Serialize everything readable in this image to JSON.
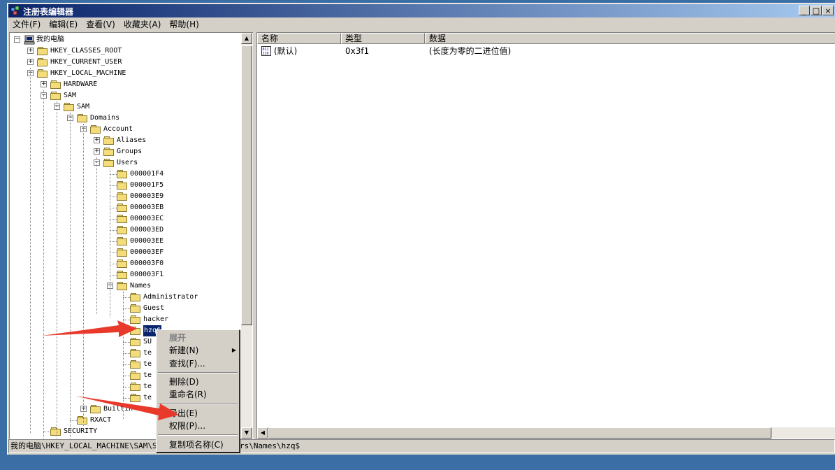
{
  "window": {
    "title": "注册表编辑器",
    "minimize": "_",
    "maximize": "□",
    "close": "×"
  },
  "menubar": [
    "文件(F)",
    "编辑(E)",
    "查看(V)",
    "收藏夹(A)",
    "帮助(H)"
  ],
  "tree": {
    "root": "我的电脑",
    "nodes": [
      {
        "label": "HKEY_CLASSES_ROOT",
        "exp": "+"
      },
      {
        "label": "HKEY_CURRENT_USER",
        "exp": "+"
      },
      {
        "label": "HKEY_LOCAL_MACHINE",
        "exp": "-"
      },
      {
        "label": "HARDWARE",
        "exp": "+"
      },
      {
        "label": "SAM",
        "exp": "-"
      },
      {
        "label": "SAM",
        "exp": "-"
      },
      {
        "label": "Domains",
        "exp": "-"
      },
      {
        "label": "Account",
        "exp": "-"
      },
      {
        "label": "Aliases",
        "exp": "+"
      },
      {
        "label": "Groups",
        "exp": "+"
      },
      {
        "label": "Users",
        "exp": "-"
      },
      {
        "label": "000001F4",
        "exp": ""
      },
      {
        "label": "000001F5",
        "exp": ""
      },
      {
        "label": "000003E9",
        "exp": ""
      },
      {
        "label": "000003EB",
        "exp": ""
      },
      {
        "label": "000003EC",
        "exp": ""
      },
      {
        "label": "000003ED",
        "exp": ""
      },
      {
        "label": "000003EE",
        "exp": ""
      },
      {
        "label": "000003EF",
        "exp": ""
      },
      {
        "label": "000003F0",
        "exp": ""
      },
      {
        "label": "000003F1",
        "exp": ""
      },
      {
        "label": "Names",
        "exp": "-"
      },
      {
        "label": "Administrator",
        "exp": ""
      },
      {
        "label": "Guest",
        "exp": ""
      },
      {
        "label": "hacker",
        "exp": ""
      },
      {
        "label": "hzq$",
        "exp": ""
      },
      {
        "label": "SU",
        "exp": ""
      },
      {
        "label": "te",
        "exp": ""
      },
      {
        "label": "te",
        "exp": ""
      },
      {
        "label": "te",
        "exp": ""
      },
      {
        "label": "te",
        "exp": ""
      },
      {
        "label": "te",
        "exp": ""
      },
      {
        "label": "Builtin",
        "exp": "+"
      },
      {
        "label": "RXACT",
        "exp": ""
      },
      {
        "label": "SECURITY",
        "exp": ""
      }
    ]
  },
  "list": {
    "headers": [
      "名称",
      "类型",
      "数据"
    ],
    "rows": [
      {
        "name": "(默认)",
        "type": "0x3f1",
        "data": "(长度为零的二进位值)"
      }
    ]
  },
  "status": {
    "path": "我的电脑\\HKEY_LOCAL_MACHINE\\SAM\\SAM",
    "path_tail": "rs\\Names\\hzq$"
  },
  "context_menu": {
    "expand": "展开",
    "new": "新建(N)",
    "find": "查找(F)...",
    "delete": "删除(D)",
    "rename": "重命名(R)",
    "export": "导出(E)",
    "permissions": "权限(P)...",
    "copy_key_name": "复制项名称(C)"
  },
  "colors": {
    "titlebar": "#0a246a",
    "selection": "#0a246a",
    "arrow": "#e8392b",
    "desktop": "#3a6ea5"
  }
}
